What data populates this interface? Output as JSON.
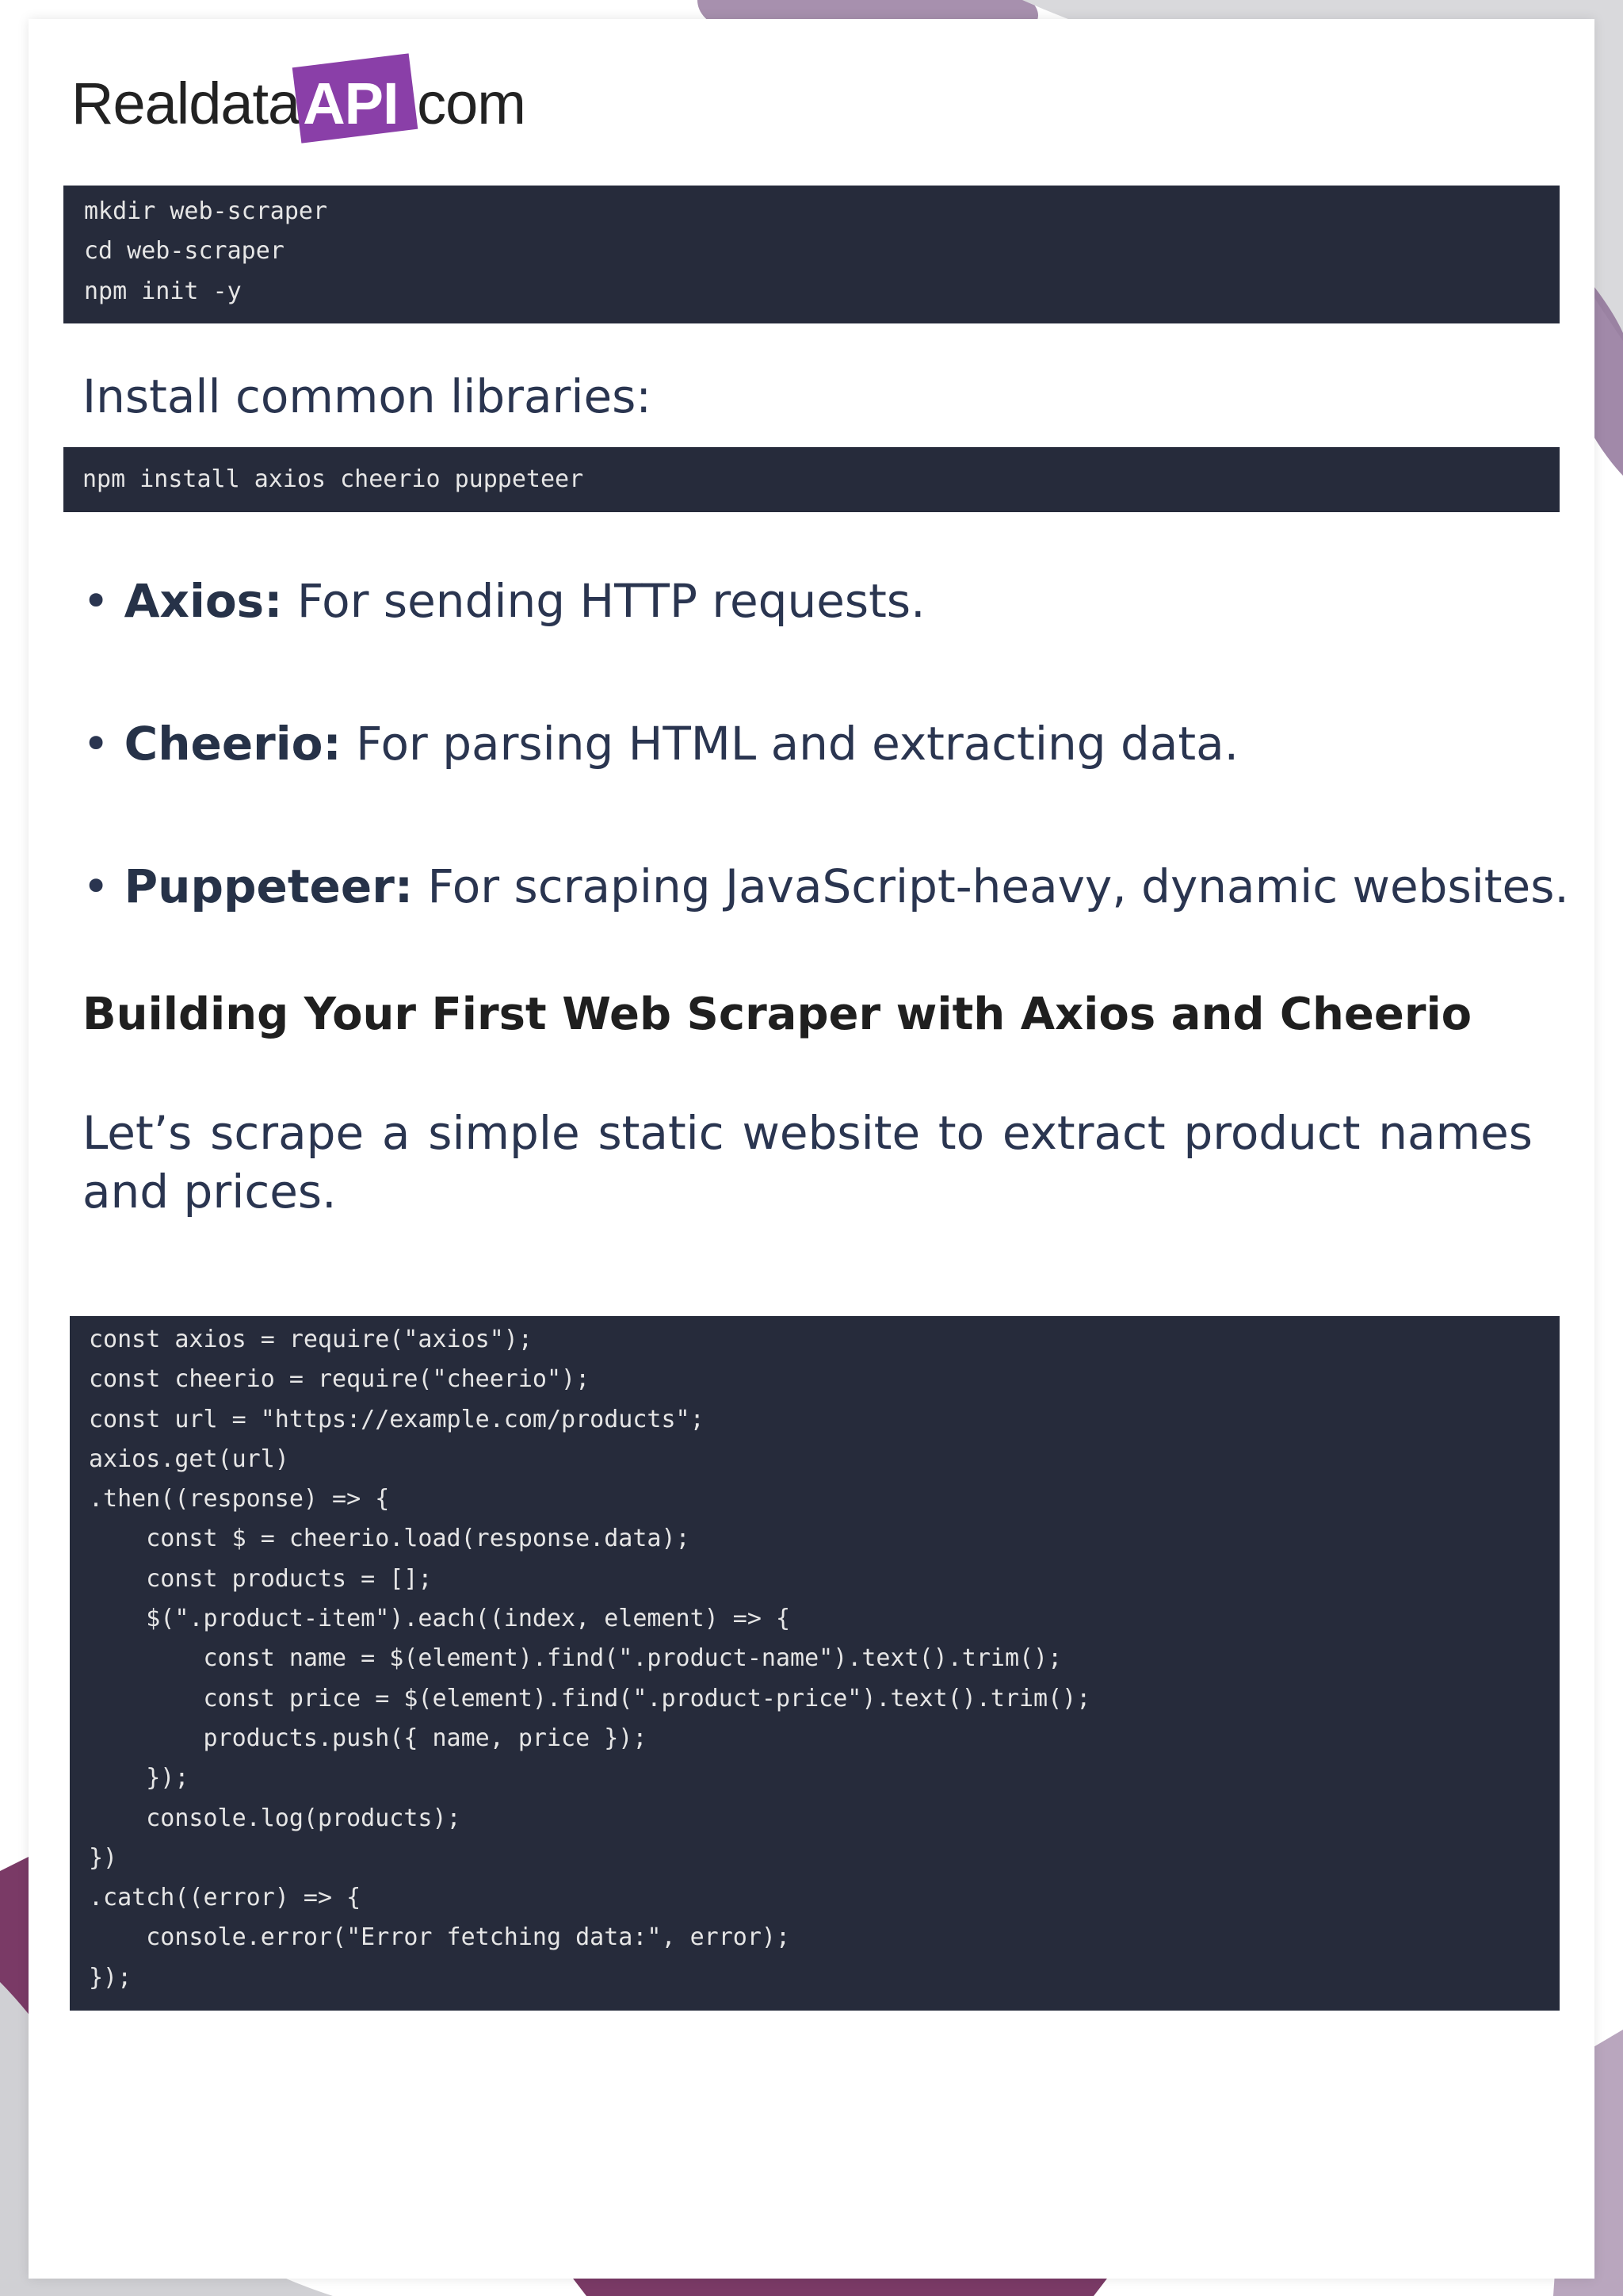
{
  "logo": {
    "prefix": "Realdata",
    "highlight": "API",
    "suffix": ".com"
  },
  "code_block_1": [
    "mkdir web-scraper",
    "cd web-scraper",
    "npm init -y"
  ],
  "install_label": "Install common libraries:",
  "code_block_2": [
    "npm install axios cheerio puppeteer"
  ],
  "bullets": [
    {
      "term": "Axios:",
      "text": " For sending HTTP requests."
    },
    {
      "term": "Cheerio:",
      "text": " For parsing HTML and extracting data."
    },
    {
      "term": "Puppeteer:",
      "text": " For scraping JavaScript-heavy, dynamic websites."
    }
  ],
  "heading": "Building Your First Web Scraper with Axios and Cheerio",
  "paragraph": "Let’s scrape a simple static website to extract product names and prices.",
  "code_block_3": [
    "const axios = require(\"axios\");",
    "const cheerio = require(\"cheerio\");",
    "const url = \"https://example.com/products\";",
    "axios.get(url)",
    ".then((response) => {",
    "    const $ = cheerio.load(response.data);",
    "    const products = [];",
    "    $(\".product-item\").each((index, element) => {",
    "        const name = $(element).find(\".product-name\").text().trim();",
    "        const price = $(element).find(\".product-price\").text().trim();",
    "        products.push({ name, price });",
    "    });",
    "    console.log(products);",
    "})",
    ".catch((error) => {",
    "    console.error(\"Error fetching data:\", error);",
    "});"
  ],
  "colors": {
    "code_bg": "#262b3b",
    "accent": "#8a3fa8",
    "text": "#2a3550"
  }
}
